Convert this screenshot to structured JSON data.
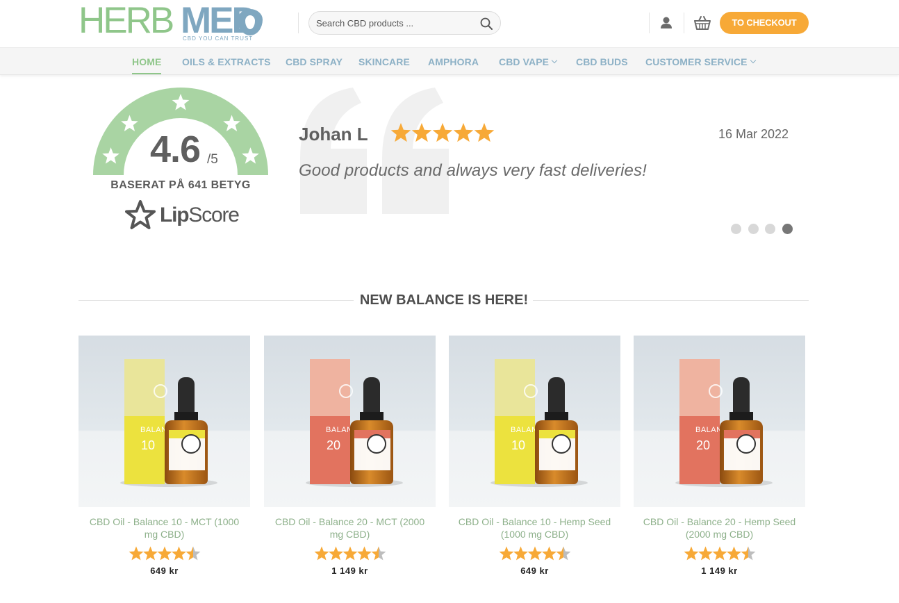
{
  "header": {
    "logo_herb": "HERB",
    "logo_med": "MED",
    "logo_tagline": "CBD YOU CAN TRUST",
    "search_placeholder": "Search CBD products ...",
    "checkout_label": "TO CHECKOUT",
    "icons": [
      "search-icon",
      "user-icon",
      "cart-icon"
    ]
  },
  "nav": {
    "items": [
      {
        "label": "HOME",
        "active": true
      },
      {
        "label": "OILS & EXTRACTS"
      },
      {
        "label": "CBD SPRAY"
      },
      {
        "label": "SKINCARE"
      },
      {
        "label": "AMPHORA"
      },
      {
        "label": "CBD VAPE",
        "has_dropdown": true
      },
      {
        "label": "CBD BUDS"
      },
      {
        "label": "CUSTOMER SERVICE",
        "has_dropdown": true
      }
    ]
  },
  "rating": {
    "score": "4.6",
    "out_of": "/5",
    "based_on": "BASERAT PÅ 641 BETYG",
    "provider_lip": "Lip",
    "provider_score": "Score"
  },
  "review": {
    "name": "Johan L",
    "stars": 5,
    "date": "16 Mar 2022",
    "text": "Good products and always very fast deliveries!",
    "slides": 4,
    "active_slide": 4
  },
  "section": {
    "title": "NEW BALANCE IS HERE!"
  },
  "products": [
    {
      "name": "CBD Oil - Balance 10 - MCT (1000 mg CBD)",
      "rating": 4.5,
      "price": "649 kr",
      "box_number": "10",
      "box_label": "BALANCE",
      "variant": "yellow"
    },
    {
      "name": "CBD Oil - Balance 20 - MCT (2000 mg CBD)",
      "rating": 4.5,
      "price": "1 149 kr",
      "box_number": "20",
      "box_label": "BALANCE",
      "variant": "red"
    },
    {
      "name": "CBD Oil - Balance 10 - Hemp Seed (1000 mg CBD)",
      "rating": 4.5,
      "price": "649 kr",
      "box_number": "10",
      "box_label": "BALANCE",
      "variant": "yellow"
    },
    {
      "name": "CBD Oil - Balance 20 - Hemp Seed (2000 mg CBD)",
      "rating": 4.5,
      "price": "1 149 kr",
      "box_number": "20",
      "box_label": "BALANCE",
      "variant": "red"
    }
  ],
  "colors": {
    "green": "#8fc68a",
    "blue": "#8db1c6",
    "orange": "#f7a937",
    "star": "#f7a937",
    "star_empty": "#bdbdbd",
    "yellow_box": "#e9e59a",
    "yellow_box_dark": "#ece23e",
    "red_box": "#efb3a0",
    "red_box_dark": "#e2735f"
  }
}
